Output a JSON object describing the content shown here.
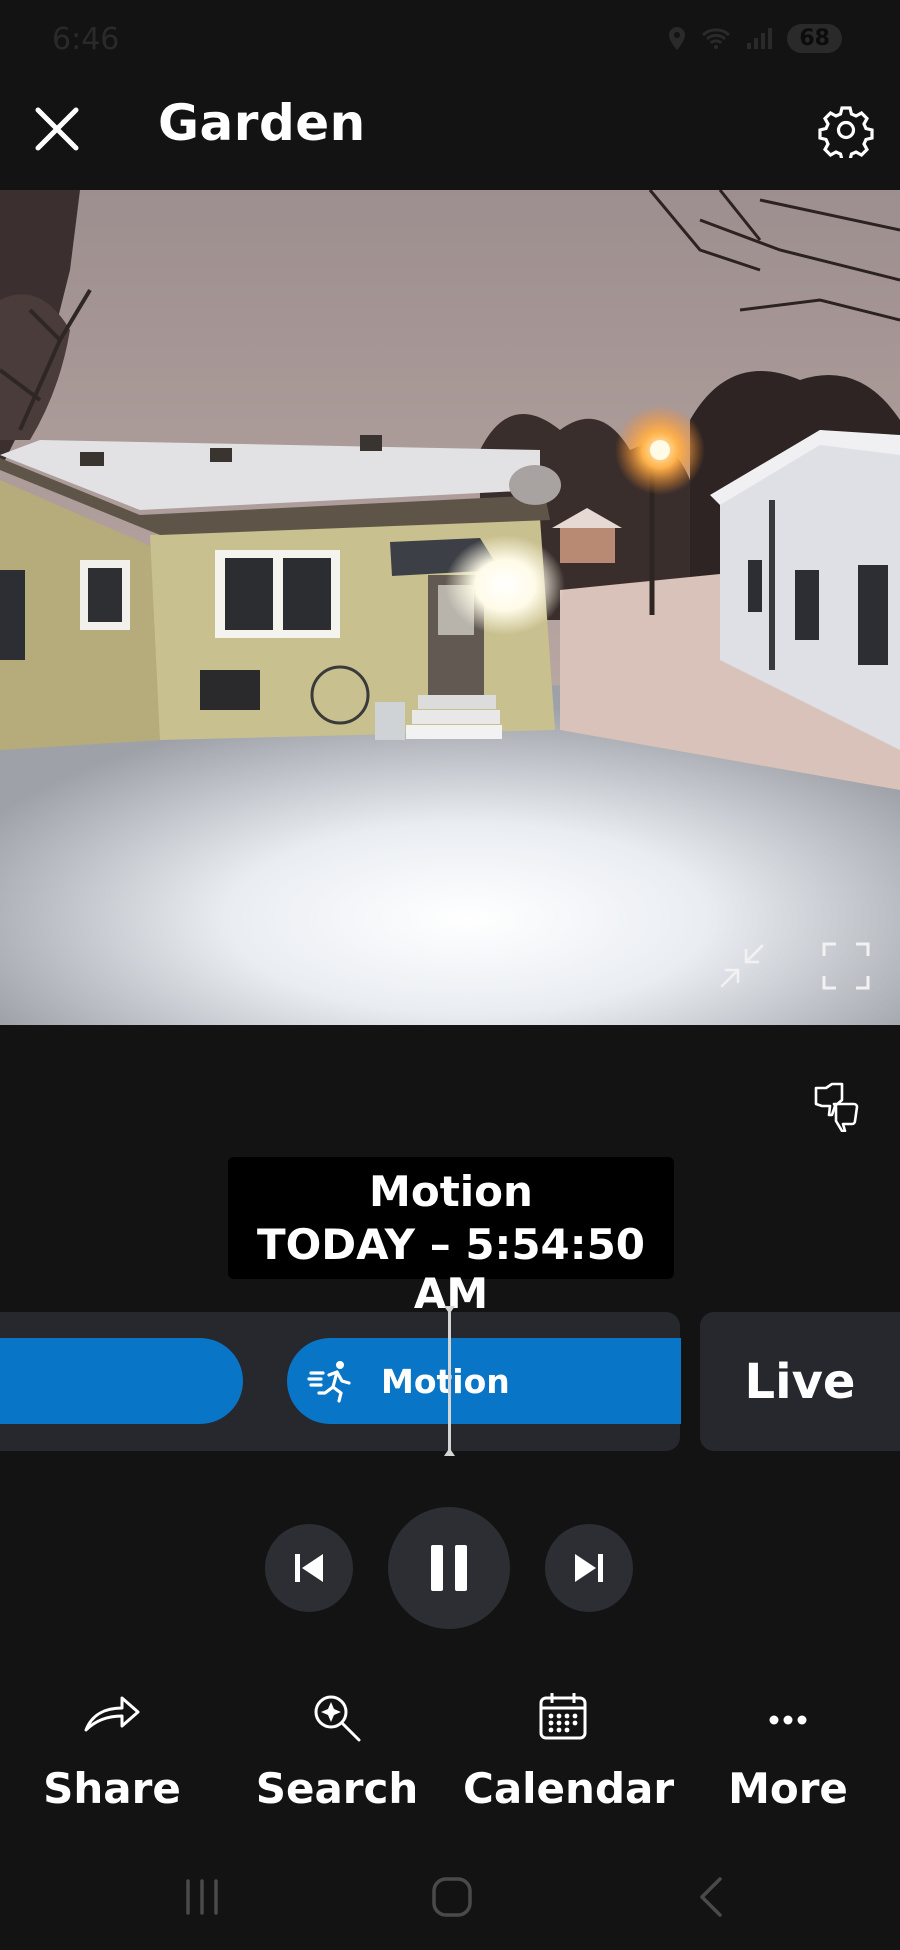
{
  "status_bar": {
    "time": "6:46",
    "battery": "68"
  },
  "header": {
    "title": "Garden"
  },
  "event": {
    "type": "Motion",
    "time": "TODAY – 5:54:50 AM"
  },
  "timeline": {
    "segment_label": "Motion",
    "live_label": "Live"
  },
  "actions": [
    {
      "label": "Share",
      "icon": "share-arrow-icon"
    },
    {
      "label": "Search",
      "icon": "search-sparkle-icon"
    },
    {
      "label": "Calendar",
      "icon": "calendar-icon"
    },
    {
      "label": "More",
      "icon": "more-dots-icon"
    }
  ],
  "colors": {
    "background": "#131314",
    "accent": "#0875c6",
    "track": "#26282d"
  }
}
